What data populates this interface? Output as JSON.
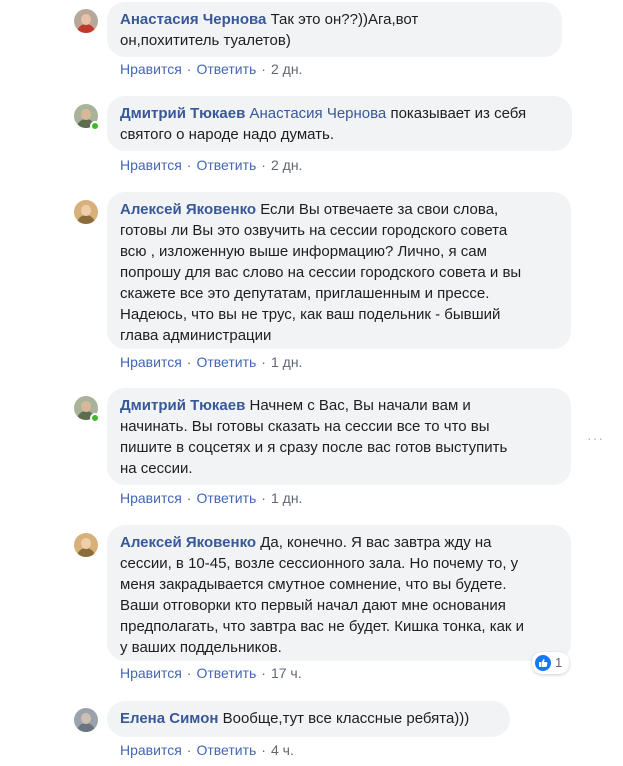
{
  "comments": [
    {
      "author": "Анастасия Чернова",
      "mention": "",
      "text_lines": [
        "Так это он??))Ага,вот",
        "он,похититель туалетов)"
      ],
      "actions": {
        "like": "Нравится",
        "reply": "Ответить",
        "time": "2 дн."
      }
    },
    {
      "author": "Дмитрий Тюкаев",
      "mention": "Анастасия Чернова",
      "text_lines": [
        "показывает из себя",
        "святого о народе надо думать."
      ],
      "actions": {
        "like": "Нравится",
        "reply": "Ответить",
        "time": "2 дн."
      }
    },
    {
      "author": "Алексей Яковенко",
      "mention": "",
      "text_lines": [
        "Если Вы отвечаете за свои слова,",
        "готовы ли Вы это озвучить на сессии городского совета",
        "всю , изложенную выше информацию? Лично, я сам",
        "попрошу для вас слово на сессии городского совета и вы",
        "скажете все это депутатам, приглашенным и прессе.",
        "Надеюсь, что вы не трус, как ваш подельник - бывший",
        "глава администрации"
      ],
      "actions": {
        "like": "Нравится",
        "reply": "Ответить",
        "time": "1 дн."
      }
    },
    {
      "author": "Дмитрий Тюкаев",
      "mention": "",
      "text_lines": [
        "Начнем с Вас, Вы начали вам и",
        "начинать. Вы готовы сказать на сессии все то что вы",
        "пишите в соцсетях и я сразу после вас готов выступить",
        "на сессии."
      ],
      "actions": {
        "like": "Нравится",
        "reply": "Ответить",
        "time": "1 дн."
      }
    },
    {
      "author": "Алексей Яковенко",
      "mention": "",
      "text_lines": [
        "Да, конечно. Я вас завтра жду на",
        "сессии, в 10-45, возле сессионного зала. Но почему то, у",
        "меня закрадывается смутное сомнение, что вы будете.",
        "Ваши отговорки кто первый начал дают мне основания",
        "предполагать, что завтра вас не будет. Кишка тонка, как и",
        "у ваших поддельников."
      ],
      "actions": {
        "like": "Нравится",
        "reply": "Ответить",
        "time": "17 ч."
      },
      "reaction_count": "1"
    },
    {
      "author": "Елена Симон",
      "mention": "",
      "text_lines": [
        "Вообще,тут все классные ребята)))"
      ],
      "actions": {
        "like": "Нравится",
        "reply": "Ответить",
        "time": "4 ч."
      }
    }
  ],
  "more_icon": "more-horizontal-icon",
  "colors": {
    "author": "#385898",
    "link": "#4267b2",
    "bubble": "#f2f3f5",
    "online": "#42b72a",
    "like": "#1877f2"
  }
}
